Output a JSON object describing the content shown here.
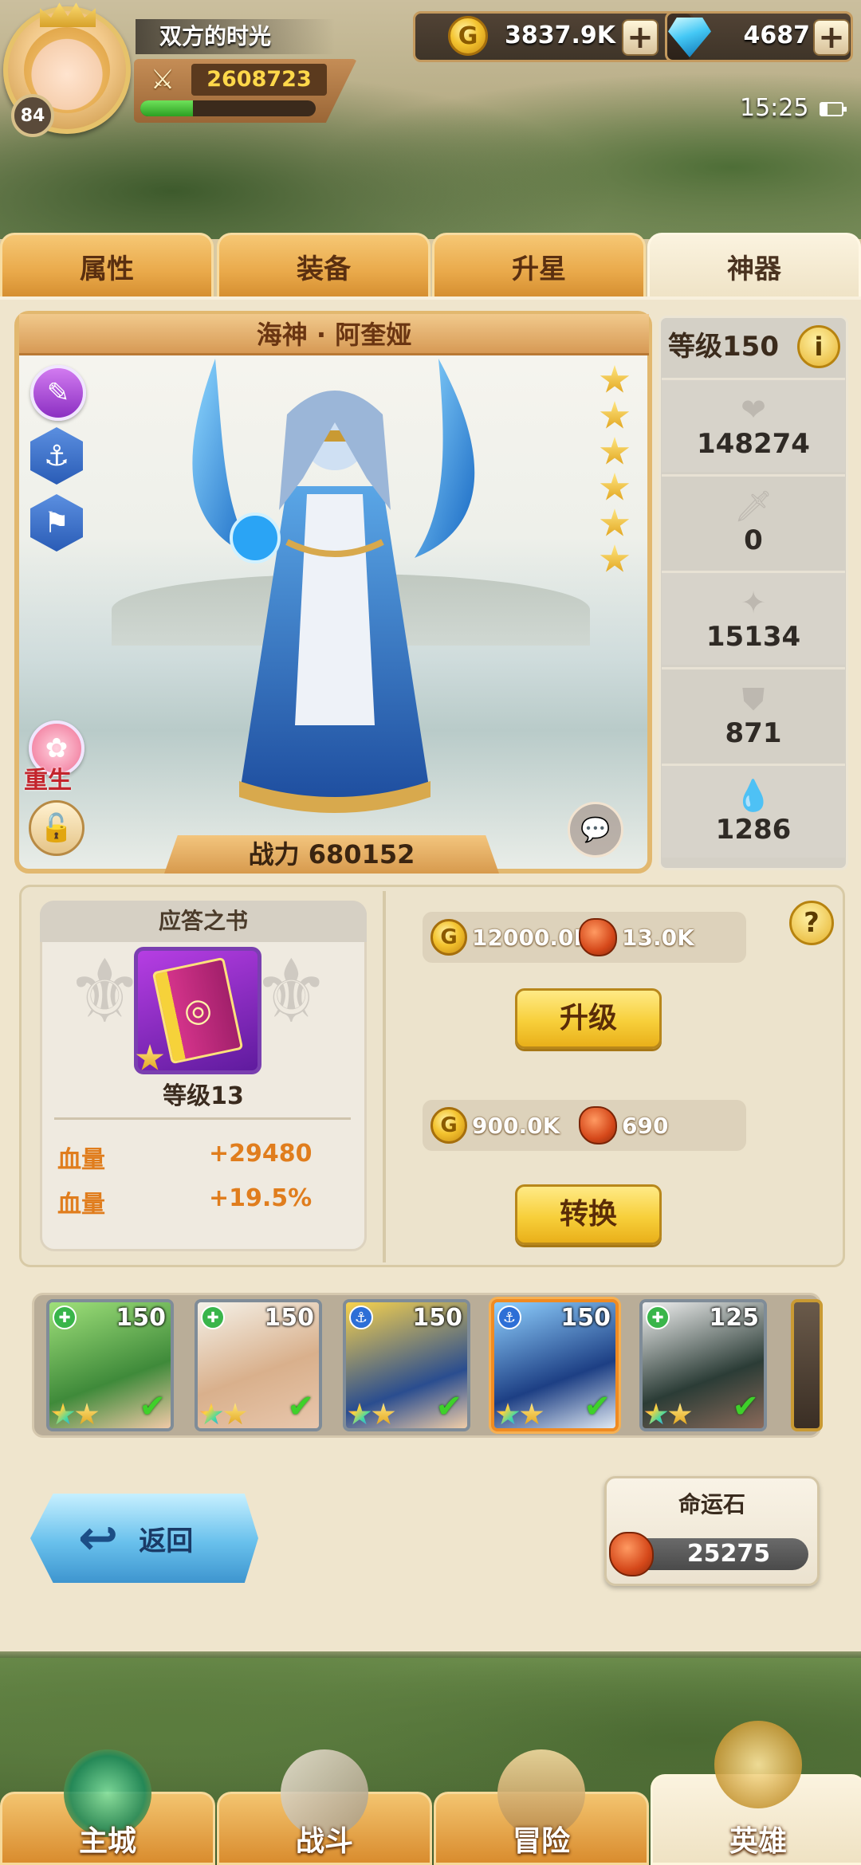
{
  "player": {
    "name": "双方的时光",
    "level": "84",
    "power": "2608723",
    "exp_fraction": 0.3
  },
  "resources": {
    "gold": "3837.9K",
    "gems": "4687"
  },
  "status_bar": {
    "time": "15:25"
  },
  "tabs": [
    {
      "label": "属性"
    },
    {
      "label": "装备"
    },
    {
      "label": "升星"
    },
    {
      "label": "神器"
    }
  ],
  "hero": {
    "name": "海神 · 阿奎娅",
    "stars": 6,
    "rebirth_label": "重生",
    "combat_power": "战力 680152"
  },
  "stats": {
    "level_label": "等级150",
    "info_symbol": "i",
    "items": [
      {
        "icon": "heart-icon",
        "value": "148274"
      },
      {
        "icon": "sword-icon",
        "value": "0"
      },
      {
        "icon": "spark-icon",
        "value": "15134"
      },
      {
        "icon": "shield-icon",
        "value": "871"
      },
      {
        "icon": "drop-icon",
        "value": "1286"
      }
    ]
  },
  "artifact": {
    "title": "应答之书",
    "level": "等级13",
    "bonuses": [
      {
        "label": "血量",
        "value": "+29480"
      },
      {
        "label": "血量",
        "value": "+19.5%"
      }
    ],
    "upgrade_cost_gold": "12000.0K",
    "upgrade_cost_stone": "13.0K",
    "upgrade_label": "升级",
    "convert_cost_gold": "900.0K",
    "convert_cost_stone": "690",
    "convert_label": "转换",
    "help_symbol": "?"
  },
  "roster": [
    {
      "level": "150",
      "type": "green",
      "stars": [
        "rainbow",
        "gold"
      ],
      "selected": false
    },
    {
      "level": "150",
      "type": "green",
      "stars": [
        "rainbow",
        "gold"
      ],
      "selected": false
    },
    {
      "level": "150",
      "type": "blue",
      "stars": [
        "rainbow",
        "gold"
      ],
      "selected": false
    },
    {
      "level": "150",
      "type": "blue",
      "stars": [
        "rainbow",
        "gold"
      ],
      "selected": true
    },
    {
      "level": "125",
      "type": "green",
      "stars": [
        "rainbow",
        "gold"
      ],
      "selected": false
    }
  ],
  "footer": {
    "back_label": "返回",
    "fate_stone_title": "命运石",
    "fate_stone_count": "25275"
  },
  "nav": [
    {
      "label": "主城",
      "active": false
    },
    {
      "label": "战斗",
      "active": false
    },
    {
      "label": "冒险",
      "active": false
    },
    {
      "label": "英雄",
      "active": true
    }
  ],
  "colors": {
    "accent_orange": "#e07d1d",
    "tab_active": "#fbf3df",
    "button_yellow": "#f7cf3a",
    "selected_border": "#f08b22"
  }
}
